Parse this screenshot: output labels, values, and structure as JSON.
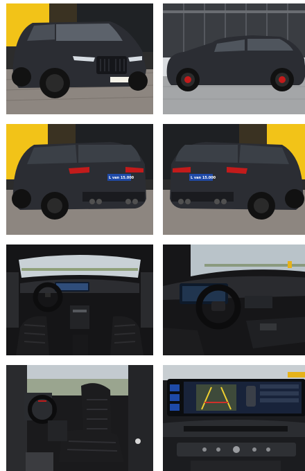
{
  "gallery": {
    "photos": [
      {
        "id": 1,
        "subject": "front-three-quarter"
      },
      {
        "id": 2,
        "subject": "side-profile"
      },
      {
        "id": 3,
        "subject": "rear-left-three-quarter"
      },
      {
        "id": 4,
        "subject": "rear-right-three-quarter"
      },
      {
        "id": 5,
        "subject": "dashboard-interior"
      },
      {
        "id": 6,
        "subject": "steering-wheel-cockpit"
      },
      {
        "id": 7,
        "subject": "front-seats"
      },
      {
        "id": 8,
        "subject": "infotainment-rear-camera"
      }
    ],
    "plate_text": "L van 15.000"
  },
  "colors": {
    "body": "#2b2d33",
    "wall_yellow": "#f2c318",
    "brake_red": "#c21b1b",
    "leather": "#1c1c1e"
  }
}
